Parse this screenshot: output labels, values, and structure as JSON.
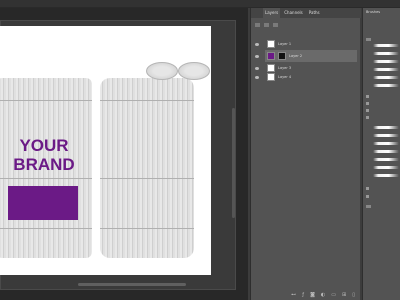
{
  "canvas": {
    "brand_text": "YOUR\nBRAND",
    "brand_color": "#6b1a86"
  },
  "layers_panel": {
    "tabs": [
      "Layers",
      "Channels",
      "Paths"
    ],
    "layers": [
      {
        "name": "Layer 1",
        "thumb": "white",
        "selected": false
      },
      {
        "name": "Layer 2",
        "thumb": "purple",
        "selected": true
      },
      {
        "name": "Layer 3",
        "thumb": "white",
        "selected": false
      },
      {
        "name": "Layer 4",
        "thumb": "white",
        "selected": false
      }
    ],
    "footer_icons": [
      "link-icon",
      "fx-icon",
      "mask-icon",
      "adjustment-icon",
      "folder-icon",
      "new-layer-icon",
      "trash-icon"
    ]
  },
  "brush_panel": {
    "title": "Brushes"
  },
  "colors": {
    "accent": "#6b1a86",
    "panel_bg": "#535353",
    "workspace_bg": "#282828"
  }
}
